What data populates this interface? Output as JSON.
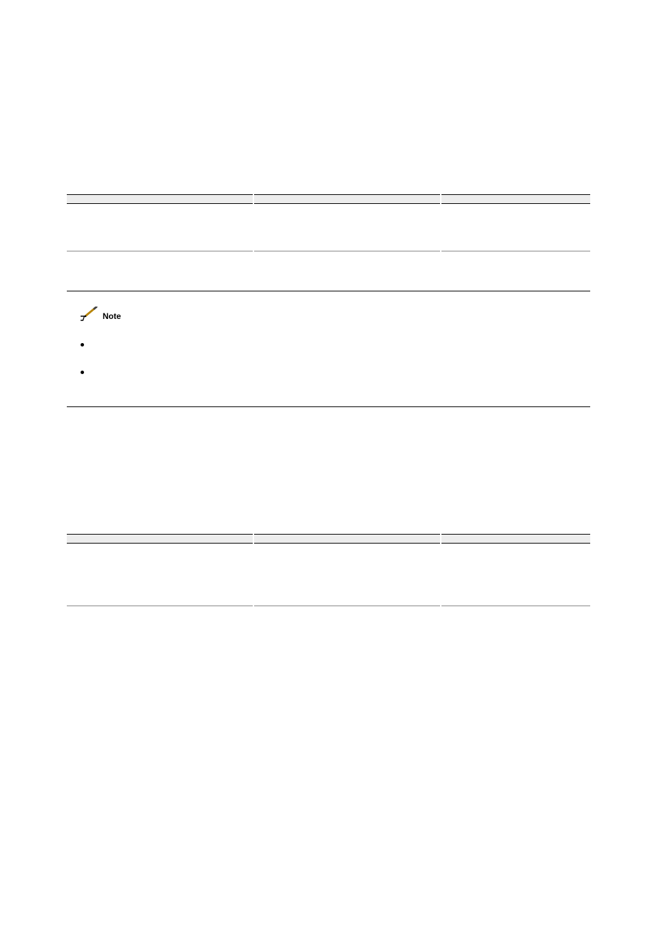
{
  "table1": {
    "headers": [
      "",
      "",
      ""
    ],
    "row": [
      "",
      "",
      ""
    ]
  },
  "note": {
    "label": "Note",
    "bullets": [
      "",
      ""
    ]
  },
  "table2": {
    "headers": [
      "",
      "",
      ""
    ],
    "row": [
      "",
      "",
      ""
    ]
  }
}
